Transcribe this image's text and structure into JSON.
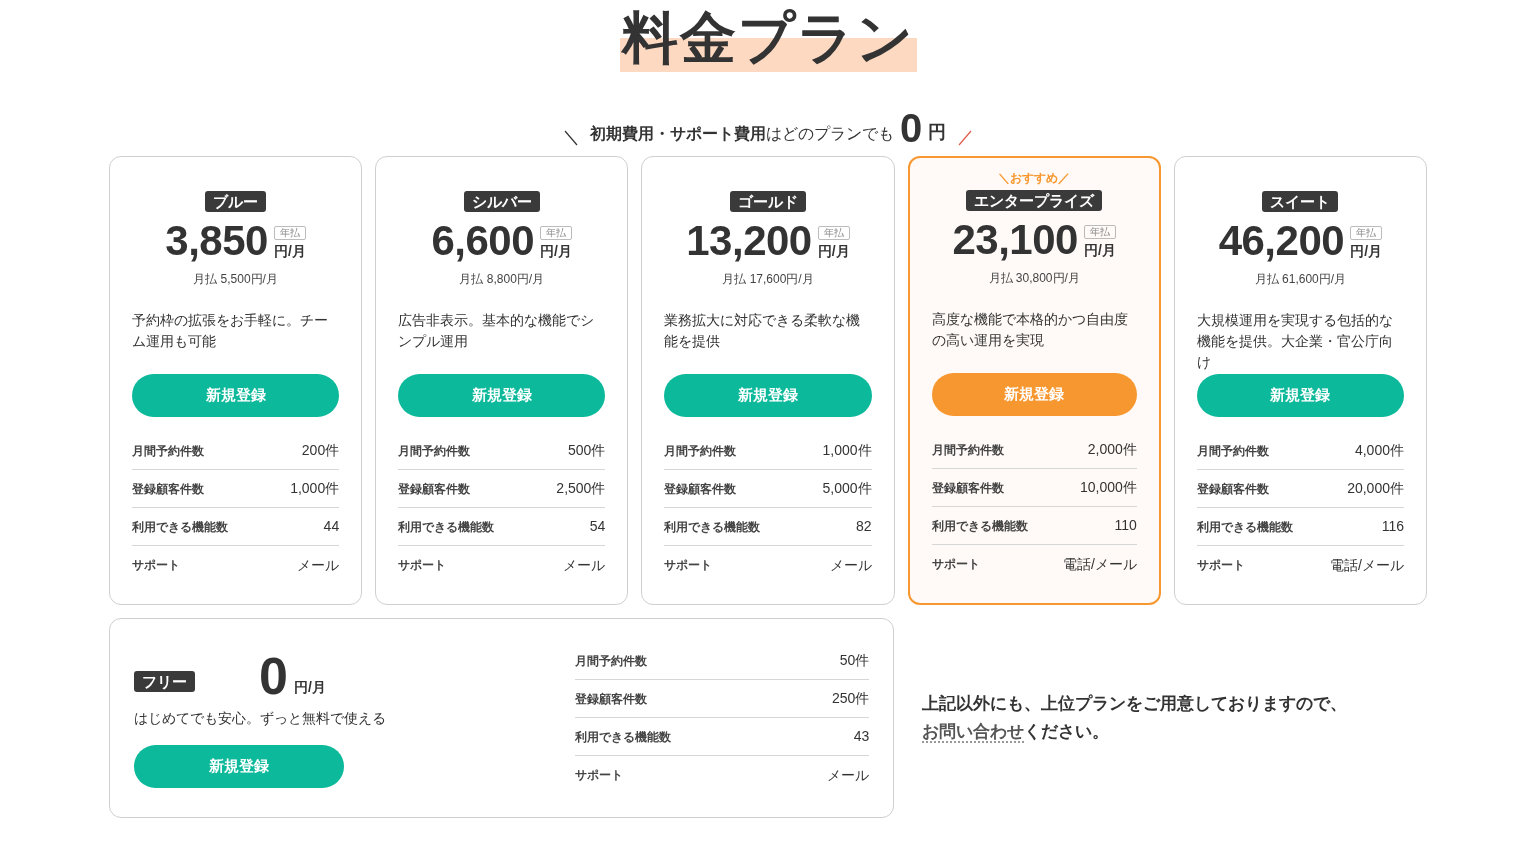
{
  "title": "料金プラン",
  "subtitle": {
    "text": "**初期費用・サポート費用**はどのプランでも",
    "amount": "0",
    "currency": "円"
  },
  "plans": [
    {
      "name": "ブルー",
      "price": "3,850",
      "billing_badge": "年払",
      "unit": "円/月",
      "monthly_price": "月払 5,500円/月",
      "description": "予約枠の拡張をお手軽に。チーム運用も可能",
      "button": "新規登録",
      "recommended": false,
      "specs": [
        {
          "label": "月間予約件数",
          "value": "200件"
        },
        {
          "label": "登録顧客件数",
          "value": "1,000件"
        },
        {
          "label": "利用できる機能数",
          "value": "44"
        },
        {
          "label": "サポート",
          "value": "メール"
        }
      ]
    },
    {
      "name": "シルバー",
      "price": "6,600",
      "billing_badge": "年払",
      "unit": "円/月",
      "monthly_price": "月払 8,800円/月",
      "description": "広告非表示。基本的な機能でシンプル運用",
      "button": "新規登録",
      "recommended": false,
      "specs": [
        {
          "label": "月間予約件数",
          "value": "500件"
        },
        {
          "label": "登録顧客件数",
          "value": "2,500件"
        },
        {
          "label": "利用できる機能数",
          "value": "54"
        },
        {
          "label": "サポート",
          "value": "メール"
        }
      ]
    },
    {
      "name": "ゴールド",
      "price": "13,200",
      "billing_badge": "年払",
      "unit": "円/月",
      "monthly_price": "月払 17,600円/月",
      "description": "業務拡大に対応できる柔軟な機能を提供",
      "button": "新規登録",
      "recommended": false,
      "specs": [
        {
          "label": "月間予約件数",
          "value": "1,000件"
        },
        {
          "label": "登録顧客件数",
          "value": "5,000件"
        },
        {
          "label": "利用できる機能数",
          "value": "82"
        },
        {
          "label": "サポート",
          "value": "メール"
        }
      ]
    },
    {
      "name": "エンタープライズ",
      "recommend_label": "＼おすすめ／",
      "price": "23,100",
      "billing_badge": "年払",
      "unit": "円/月",
      "monthly_price": "月払 30,800円/月",
      "description": "高度な機能で本格的かつ自由度の高い運用を実現",
      "button": "新規登録",
      "recommended": true,
      "specs": [
        {
          "label": "月間予約件数",
          "value": "2,000件"
        },
        {
          "label": "登録顧客件数",
          "value": "10,000件"
        },
        {
          "label": "利用できる機能数",
          "value": "110"
        },
        {
          "label": "サポート",
          "value": "電話/メール"
        }
      ]
    },
    {
      "name": "スイート",
      "price": "46,200",
      "billing_badge": "年払",
      "unit": "円/月",
      "monthly_price": "月払 61,600円/月",
      "description": "大規模運用を実現する包括的な機能を提供。大企業・官公庁向け",
      "button": "新規登録",
      "recommended": false,
      "specs": [
        {
          "label": "月間予約件数",
          "value": "4,000件"
        },
        {
          "label": "登録顧客件数",
          "value": "20,000件"
        },
        {
          "label": "利用できる機能数",
          "value": "116"
        },
        {
          "label": "サポート",
          "value": "電話/メール"
        }
      ]
    }
  ],
  "free_plan": {
    "name": "フリー",
    "price": "0",
    "unit": "円/月",
    "description": "はじめてでも安心。ずっと無料で使える",
    "button": "新規登録",
    "specs": [
      {
        "label": "月間予約件数",
        "value": "50件"
      },
      {
        "label": "登録顧客件数",
        "value": "250件"
      },
      {
        "label": "利用できる機能数",
        "value": "43"
      },
      {
        "label": "サポート",
        "value": "メール"
      }
    ]
  },
  "note": {
    "text": "上記以外にも、上位プランをご用意しておりますので、",
    "link": "お問い合わせ",
    "after": "ください。"
  }
}
